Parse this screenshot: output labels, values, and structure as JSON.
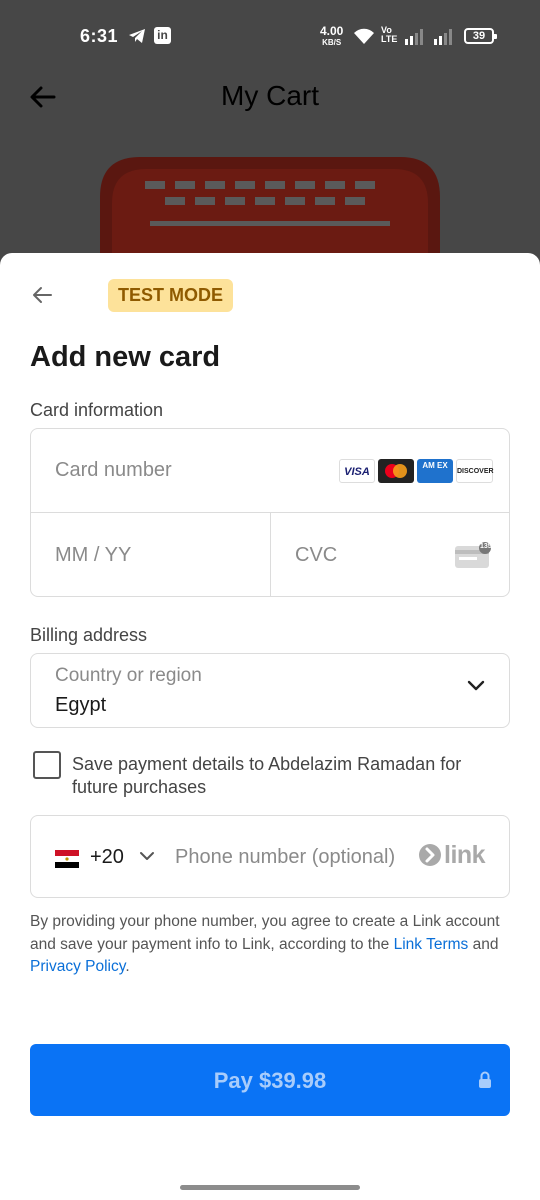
{
  "status_bar": {
    "time": "6:31",
    "net_speed": "4.00",
    "net_unit": "KB/S",
    "volte_top": "Vo",
    "volte_bottom": "LTE",
    "battery": "39"
  },
  "header": {
    "title": "My Cart"
  },
  "sheet": {
    "badge": "TEST MODE",
    "title": "Add new card",
    "card_info_label": "Card information",
    "card_number_placeholder": "Card number",
    "brands": [
      "VISA",
      "",
      "AM EX",
      "DISCOVER"
    ],
    "expiry_placeholder": "MM / YY",
    "cvc_placeholder": "CVC",
    "cvc_icon_text": "135",
    "billing_label": "Billing address",
    "country_placeholder": "Country or region",
    "country_value": "Egypt",
    "save_text": "Save payment details to Abdelazim Ramadan for future purchases",
    "phone_code": "+20",
    "phone_placeholder": "Phone number (optional)",
    "link_brand": "link",
    "legal_prefix": "By providing your phone number, you agree to create a Link account and save your payment info to Link, according to the ",
    "legal_link_terms": "Link Terms",
    "legal_and": " and ",
    "legal_link_privacy": "Privacy Policy",
    "legal_suffix": ".",
    "pay_label": "Pay $39.98"
  },
  "colors": {
    "accent": "#0a73f5",
    "badge_bg": "#fde29a",
    "badge_text": "#8f5a00",
    "link": "#0a6fd8"
  }
}
